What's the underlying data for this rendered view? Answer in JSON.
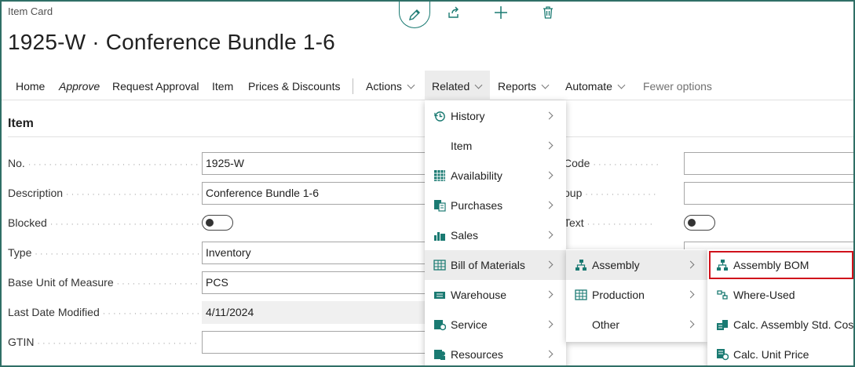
{
  "page": {
    "caption": "Item Card",
    "title": "1925-W · Conference Bundle 1-6"
  },
  "toolbar_icons": [
    "edit-icon",
    "share-icon",
    "add-icon",
    "delete-icon"
  ],
  "actions": {
    "home": "Home",
    "approve": "Approve",
    "request_approval": "Request Approval",
    "item": "Item",
    "prices_discounts": "Prices & Discounts",
    "actions": "Actions",
    "related": "Related",
    "reports": "Reports",
    "automate": "Automate",
    "fewer_options": "Fewer options"
  },
  "section": {
    "title": "Item"
  },
  "fields": {
    "no": {
      "label": "No.",
      "value": "1925-W"
    },
    "description": {
      "label": "Description",
      "value": "Conference Bundle 1-6"
    },
    "blocked": {
      "label": "Blocked",
      "value": false
    },
    "type": {
      "label": "Type",
      "value": "Inventory"
    },
    "base_uom": {
      "label": "Base Unit of Measure",
      "value": "PCS"
    },
    "last_modified": {
      "label": "Last Date Modified",
      "value": "4/11/2024"
    },
    "gtin": {
      "label": "GTIN",
      "value": ""
    }
  },
  "right_fields": {
    "code_label": "Code",
    "oup_label": "oup",
    "text_label": "Text",
    "text_toggle": false
  },
  "related_menu": {
    "history": "History",
    "item": "Item",
    "availability": "Availability",
    "purchases": "Purchases",
    "sales": "Sales",
    "bom": "Bill of Materials",
    "warehouse": "Warehouse",
    "service": "Service",
    "resources": "Resources"
  },
  "bom_menu": {
    "assembly": "Assembly",
    "production": "Production",
    "other": "Other"
  },
  "assembly_menu": {
    "assembly_bom": "Assembly BOM",
    "where_used": "Where-Used",
    "calc_std_cost": "Calc. Assembly Std. Cost",
    "calc_unit_price": "Calc. Unit Price"
  },
  "colors": {
    "accent": "#1a7a72",
    "highlight_box": "#d0121b",
    "menu_hover": "#ececec"
  }
}
